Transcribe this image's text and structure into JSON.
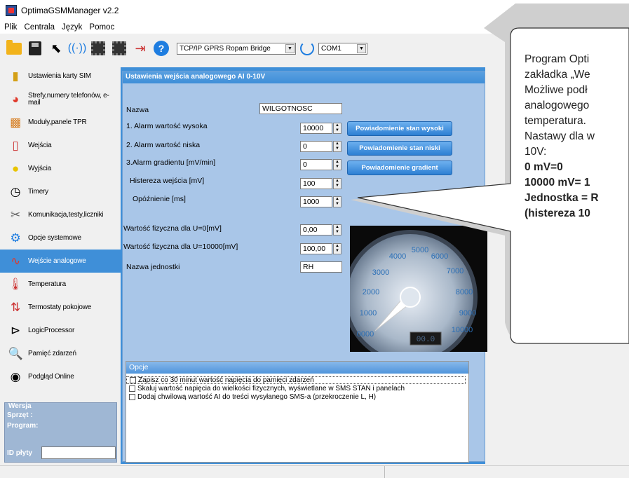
{
  "app": {
    "title": "OptimaGSMManager v2.2"
  },
  "menu": [
    "Plik",
    "Centrala",
    "Język",
    "Pomoc"
  ],
  "toolbar": {
    "connection_type": "TCP/IP GPRS Ropam Bridge",
    "port": "COM1"
  },
  "sidebar": {
    "items": [
      {
        "label": "Ustawienia karty SIM",
        "icon": "sim-card-icon"
      },
      {
        "label": "Strefy,numery telefonów, e-mail",
        "icon": "pie-chart-icon"
      },
      {
        "label": "Moduły,panele TPR",
        "icon": "cubes-icon"
      },
      {
        "label": "Wejścia",
        "icon": "input-icon"
      },
      {
        "label": "Wyjścia",
        "icon": "bulb-icon"
      },
      {
        "label": "Timery",
        "icon": "clock-icon"
      },
      {
        "label": "Komunikacja,testy,liczniki",
        "icon": "tools-icon"
      },
      {
        "label": "Opcje systemowe",
        "icon": "gear-icon"
      },
      {
        "label": "Wejście analogowe",
        "icon": "waveform-icon"
      },
      {
        "label": "Temperatura",
        "icon": "thermometer-icon"
      },
      {
        "label": "Termostaty pokojowe",
        "icon": "thermostat-icon"
      },
      {
        "label": "LogicProcessor",
        "icon": "logic-icon"
      },
      {
        "label": "Pamięć zdarzeń",
        "icon": "log-icon"
      },
      {
        "label": "Podgląd Online",
        "icon": "online-icon"
      }
    ],
    "active_index": 8
  },
  "version": {
    "legend": "Wersja",
    "hardware": "Sprzęt :",
    "program": "Program:",
    "board_id": "ID płyty",
    "board_id_value": ""
  },
  "panel": {
    "title": "Ustawienia wejścia analogowego AI  0-10V"
  },
  "form": {
    "name_label": "Nazwa",
    "name_value": "WILGOTNOSC",
    "alarm_high_label": "1. Alarm wartość wysoka",
    "alarm_high_value": "10000",
    "alarm_low_label": "2. Alarm wartość niska",
    "alarm_low_value": "0",
    "alarm_grad_label": "3.Alarm gradientu [mV/min]",
    "alarm_grad_value": "0",
    "hysteresis_label": "Histereza wejścia [mV]",
    "hysteresis_value": "100",
    "delay_label": "Opóźnienie [ms]",
    "delay_value": "1000",
    "phys0_label": "Wartość fizyczna dla U=0[mV]",
    "phys0_value": "0,00",
    "phys10000_label": "Wartość fizyczna dla U=10000[mV]",
    "phys10000_value": "100,00",
    "unit_label": "Nazwa jednostki",
    "unit_value": "RH"
  },
  "buttons": {
    "notify_high": "Powiadomienie stan wysoki",
    "notify_low": "Powiadomienie stan niski",
    "notify_gradient": "Powiadomienie gradient"
  },
  "gauge": {
    "ticks": [
      "0000",
      "1000",
      "2000",
      "3000",
      "4000",
      "5000",
      "6000",
      "7000",
      "8000",
      "9000",
      "10000"
    ],
    "readout": "00.0"
  },
  "options": {
    "title": "Opcje",
    "items": [
      "Zapisz co 30 minut wartość napięcia do pamięci zdarzeń",
      "Skaluj wartość napięcia do wielkości fizycznych, wyświetlane w SMS STAN  i panelach",
      "Dodaj chwilową wartość AI do treści wysyłanego SMS-a (przekroczenie L, H)"
    ]
  },
  "callout": {
    "l1": "Program Opti",
    "l2": "zakładka „We",
    "l3": "Możliwe podł",
    "l4": "analogowego",
    "l5": "temperatura.",
    "l6": "Nastawy dla w",
    "l7": "10V:",
    "b1": "0 mV=0",
    "b2": "10000 mV= 1",
    "b3": "Jednostka = R",
    "b4": "(histereza 10"
  }
}
